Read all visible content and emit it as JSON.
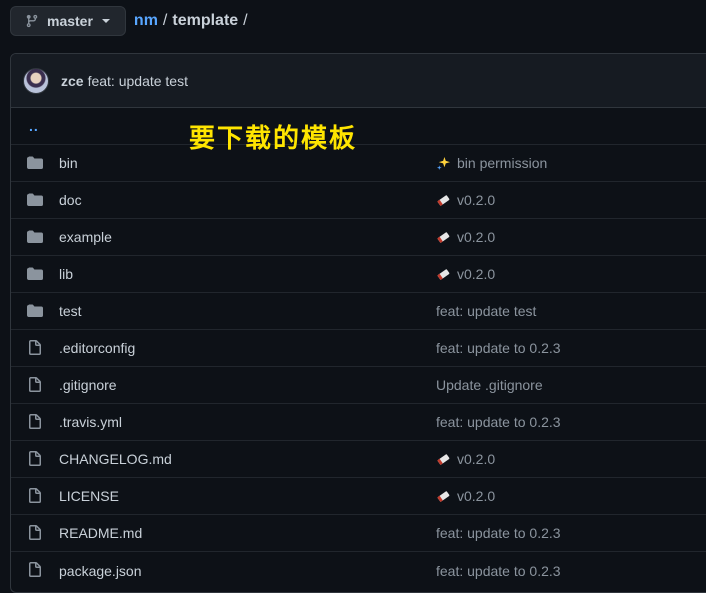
{
  "branch": {
    "label": "master",
    "icon": "git-branch-icon"
  },
  "breadcrumb": {
    "repo": "nm",
    "sep1": "/",
    "folder": "template",
    "sep2": "/"
  },
  "commit": {
    "author": "zce",
    "message": "feat: update test"
  },
  "annotation": "要下载的模板",
  "parent": {
    "label": ".."
  },
  "files": [
    {
      "type": "dir",
      "name": "bin",
      "message": "bin permission",
      "emoji": "sparkles-icon"
    },
    {
      "type": "dir",
      "name": "doc",
      "message": "v0.2.0",
      "emoji": "bookmark-icon"
    },
    {
      "type": "dir",
      "name": "example",
      "message": "v0.2.0",
      "emoji": "bookmark-icon"
    },
    {
      "type": "dir",
      "name": "lib",
      "message": "v0.2.0",
      "emoji": "bookmark-icon"
    },
    {
      "type": "dir",
      "name": "test",
      "message": "feat: update test",
      "emoji": ""
    },
    {
      "type": "file",
      "name": ".editorconfig",
      "message": "feat: update to 0.2.3",
      "emoji": ""
    },
    {
      "type": "file",
      "name": ".gitignore",
      "message": "Update .gitignore",
      "emoji": ""
    },
    {
      "type": "file",
      "name": ".travis.yml",
      "message": "feat: update to 0.2.3",
      "emoji": ""
    },
    {
      "type": "file",
      "name": "CHANGELOG.md",
      "message": "v0.2.0",
      "emoji": "bookmark-icon"
    },
    {
      "type": "file",
      "name": "LICENSE",
      "message": "v0.2.0",
      "emoji": "bookmark-icon"
    },
    {
      "type": "file",
      "name": "README.md",
      "message": "feat: update to 0.2.3",
      "emoji": ""
    },
    {
      "type": "file",
      "name": "package.json",
      "message": "feat: update to 0.2.3",
      "emoji": ""
    }
  ],
  "colors": {
    "background": "#0d1117",
    "link": "#58a6ff",
    "muted": "#8b949e",
    "annotation": "#ffe500"
  }
}
